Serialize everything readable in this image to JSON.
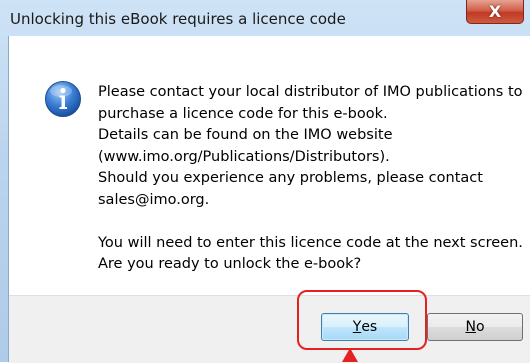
{
  "window": {
    "title": "Unlocking this eBook requires a licence code",
    "close_glyph": "X"
  },
  "icon": "info-icon",
  "message": {
    "lines": [
      "Please contact your local distributor of IMO publications to",
      "purchase a licence code for this e-book.",
      "Details can be found on the IMO website",
      "(www.imo.org/Publications/Distributors).",
      "Should you experience any problems, please contact",
      "sales@imo.org.",
      "",
      "You will need to enter this licence code at the next screen.",
      "Are you ready to unlock the e-book?"
    ]
  },
  "buttons": {
    "yes": {
      "mnemonic": "Y",
      "rest": "es"
    },
    "no": {
      "mnemonic": "N",
      "rest": "o"
    }
  },
  "colors": {
    "highlight": "#e32222",
    "yes_border": "#3c7fb1",
    "info_blue": "#2a6fc9"
  }
}
